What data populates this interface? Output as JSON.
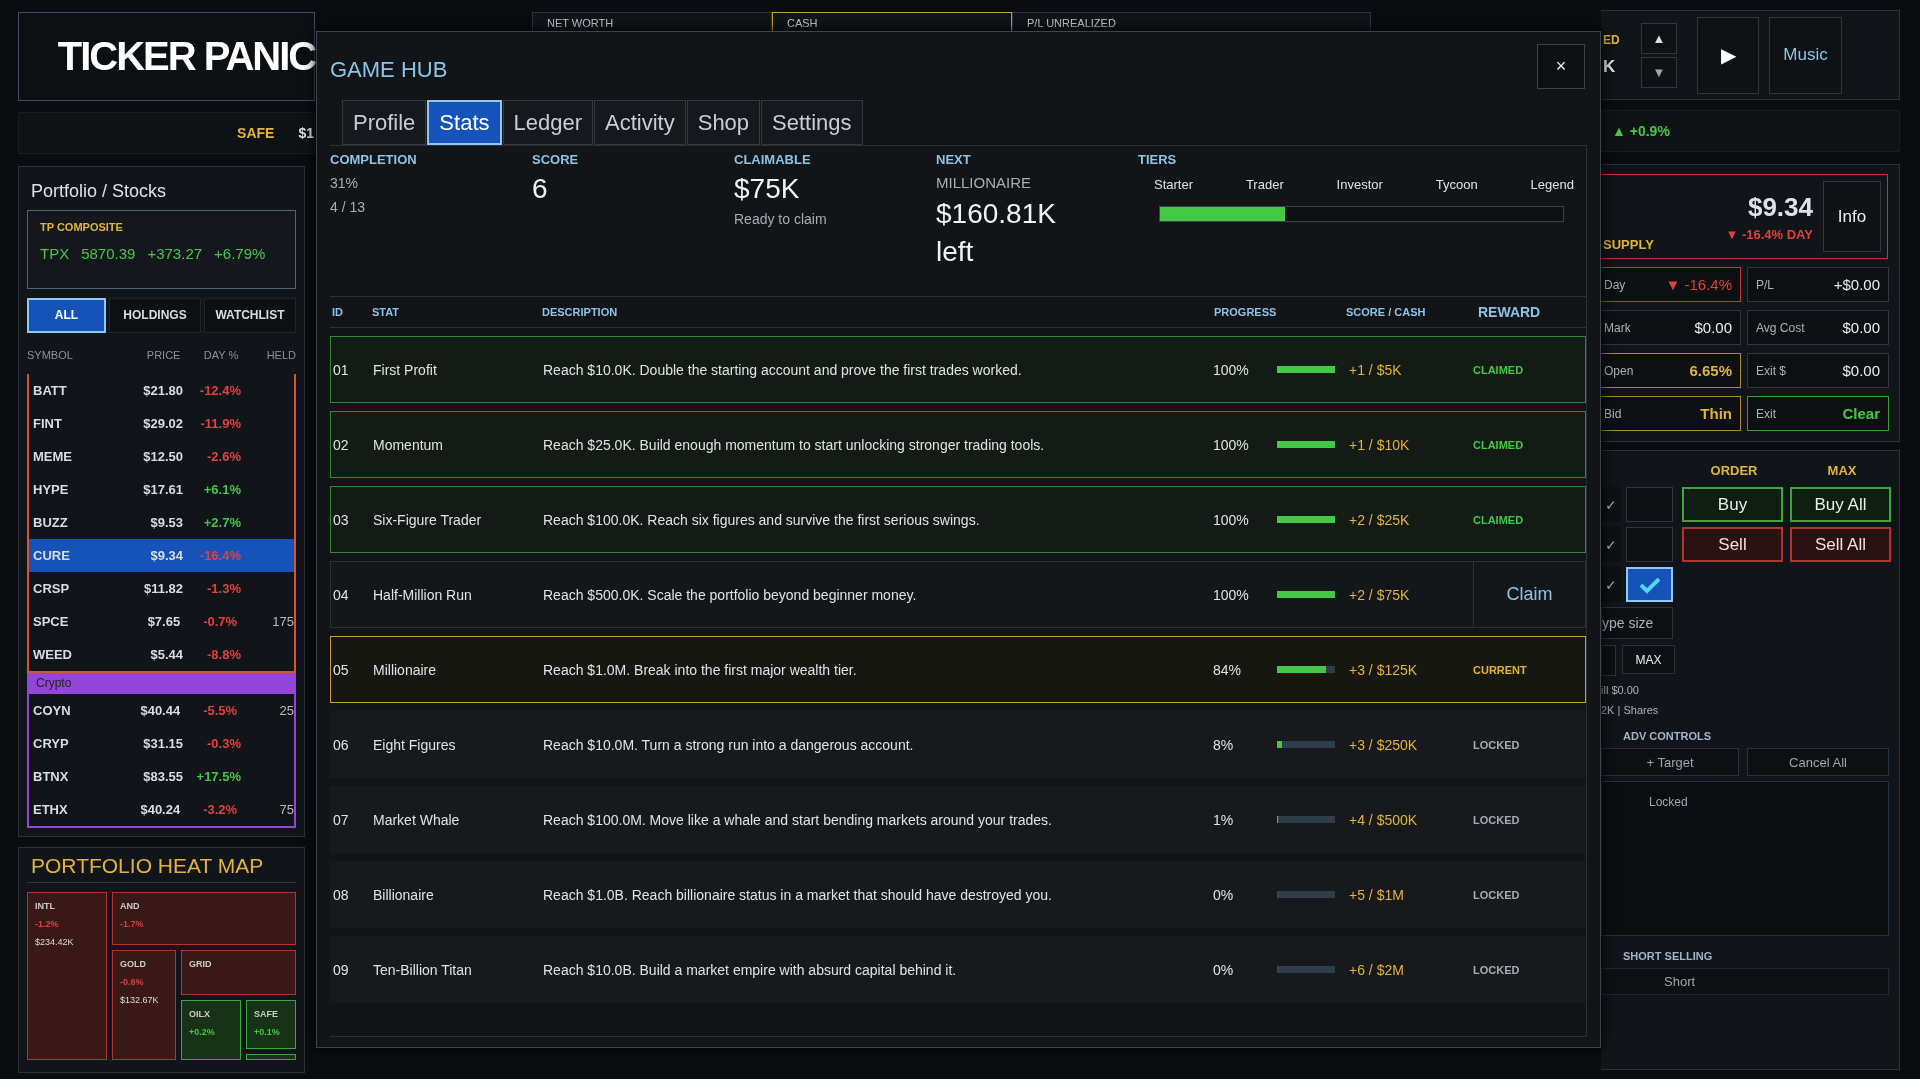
{
  "logo": {
    "title": "TICKER PANIC"
  },
  "ticker_strip": {
    "label": "SAFE",
    "value": "$1"
  },
  "portfolio": {
    "title": "Portfolio / Stocks",
    "composite": {
      "label": "TP COMPOSITE",
      "symbol": "TPX",
      "value": "5870.39",
      "change": "+373.27",
      "percent": "+6.79%"
    },
    "filters": [
      {
        "label": "ALL",
        "selected": true
      },
      {
        "label": "HOLDINGS",
        "selected": false
      },
      {
        "label": "WATCHLIST",
        "selected": false
      }
    ],
    "columns": [
      "SYMBOL",
      "PRICE",
      "DAY %",
      "HELD"
    ],
    "groups": [
      {
        "color": "#d9542b",
        "rows": [
          {
            "symbol": "BATT",
            "price": "$21.80",
            "change": "-12.4%",
            "rising": false,
            "selected": false
          },
          {
            "symbol": "FINT",
            "price": "$29.02",
            "change": "-11.9%",
            "rising": false,
            "selected": false
          },
          {
            "symbol": "MEME",
            "price": "$12.50",
            "change": "-2.6%",
            "rising": false,
            "selected": false
          },
          {
            "symbol": "HYPE",
            "price": "$17.61",
            "change": "+6.1%",
            "rising": true,
            "selected": false
          },
          {
            "symbol": "BUZZ",
            "price": "$9.53",
            "change": "+2.7%",
            "rising": true,
            "selected": false
          },
          {
            "symbol": "CURE",
            "price": "$9.34",
            "change": "-16.4%",
            "rising": false,
            "selected": true
          },
          {
            "symbol": "CRSP",
            "price": "$11.82",
            "change": "-1.3%",
            "rising": false,
            "selected": false
          },
          {
            "symbol": "SPCE",
            "price": "$7.65",
            "change": "-0.7%",
            "rising": false,
            "held": "175",
            "selected": false
          },
          {
            "symbol": "WEED",
            "price": "$5.44",
            "change": "-8.8%",
            "rising": false,
            "selected": false
          }
        ]
      },
      {
        "header": "Crypto",
        "color": "#9446d8",
        "rows": [
          {
            "symbol": "COYN",
            "price": "$40.44",
            "change": "-5.5%",
            "rising": false,
            "held": "25",
            "selected": false
          },
          {
            "symbol": "CRYP",
            "price": "$31.15",
            "change": "-0.3%",
            "rising": false,
            "selected": false
          },
          {
            "symbol": "BTNX",
            "price": "$83.55",
            "change": "+17.5%",
            "rising": true,
            "selected": false
          },
          {
            "symbol": "ETHX",
            "price": "$40.24",
            "change": "-3.2%",
            "rising": false,
            "held": "75",
            "selected": false
          }
        ]
      }
    ]
  },
  "heat_map": {
    "title": "PORTFOLIO HEAT MAP",
    "tiles": [
      {
        "symbol": "INTL",
        "change": "-1.2%",
        "value": "$234.42K",
        "rising": false
      },
      {
        "symbol": "AND",
        "change": "-1.7%",
        "rising": false
      },
      {
        "symbol": "GOLD",
        "change": "-0.6%",
        "value": "$132.67K",
        "rising": false
      },
      {
        "symbol": "GRID",
        "rising": false
      },
      {
        "symbol": "OILX",
        "change": "+0.2%",
        "rising": true
      },
      {
        "symbol": "SAFE",
        "change": "+0.1%",
        "rising": true
      },
      {
        "rising": true
      }
    ]
  },
  "top_cards": [
    {
      "label": "NET WORTH",
      "highlighted": false
    },
    {
      "label": "CASH",
      "highlighted": true
    },
    {
      "label": "P/L UNREALIZED",
      "highlighted": false
    }
  ],
  "game_hub": {
    "title": "GAME HUB",
    "close": "×",
    "tabs": [
      {
        "label": "Profile",
        "selected": false
      },
      {
        "label": "Stats",
        "selected": true
      },
      {
        "label": "Ledger",
        "selected": false
      },
      {
        "label": "Activity",
        "selected": false
      },
      {
        "label": "Shop",
        "selected": false
      },
      {
        "label": "Settings",
        "selected": false
      }
    ],
    "summary": {
      "completion": {
        "label": "COMPLETION",
        "percent": "31%",
        "count": "4 / 13"
      },
      "score": {
        "label": "SCORE",
        "value": "6"
      },
      "claimable": {
        "label": "CLAIMABLE",
        "value": "$75K",
        "note": "Ready to claim"
      },
      "next": {
        "label": "NEXT",
        "name": "MILLIONAIRE",
        "value": "$160.81K left"
      },
      "tiers": {
        "label": "TIERS",
        "names": [
          "Starter",
          "Trader",
          "Investor",
          "Tycoon",
          "Legend"
        ],
        "level": 0.31
      }
    },
    "columns": [
      "ID",
      "STAT",
      "DESCRIPTION",
      "PROGRESS",
      "SCORE / CASH",
      "REWARD"
    ],
    "rows": [
      {
        "id": "01",
        "stat": "First Profit",
        "description": "Reach $10.0K. Double the starting account and prove the first trades worked.",
        "percent": "100%",
        "level": 1,
        "score_cash": "+1 / $5K",
        "reward": "CLAIMED",
        "kind": "claimed"
      },
      {
        "id": "02",
        "stat": "Momentum",
        "description": "Reach $25.0K. Build enough momentum to start unlocking stronger trading tools.",
        "percent": "100%",
        "level": 1,
        "score_cash": "+1 / $10K",
        "reward": "CLAIMED",
        "kind": "claimed"
      },
      {
        "id": "03",
        "stat": "Six-Figure Trader",
        "description": "Reach $100.0K. Reach six figures and survive the first serious swings.",
        "percent": "100%",
        "level": 1,
        "score_cash": "+2 / $25K",
        "reward": "CLAIMED",
        "kind": "claimed"
      },
      {
        "id": "04",
        "stat": "Half-Million Run",
        "description": "Reach $500.0K. Scale the portfolio beyond beginner money.",
        "percent": "100%",
        "level": 1,
        "score_cash": "+2 / $75K",
        "reward": "Claim",
        "kind": "claim"
      },
      {
        "id": "05",
        "stat": "Millionaire",
        "description": "Reach $1.0M. Break into the first major wealth tier.",
        "percent": "84%",
        "level": 0.84,
        "score_cash": "+3 / $125K",
        "reward": "CURRENT",
        "kind": "current"
      },
      {
        "id": "06",
        "stat": "Eight Figures",
        "description": "Reach $10.0M. Turn a strong run into a dangerous account.",
        "percent": "8%",
        "level": 0.08,
        "score_cash": "+3 / $250K",
        "reward": "LOCKED",
        "kind": "locked"
      },
      {
        "id": "07",
        "stat": "Market Whale",
        "description": "Reach $100.0M. Move like a whale and start bending markets around your trades.",
        "percent": "1%",
        "level": 0.01,
        "score_cash": "+4 / $500K",
        "reward": "LOCKED",
        "kind": "locked"
      },
      {
        "id": "08",
        "stat": "Billionaire",
        "description": "Reach $1.0B. Reach billionaire status in a market that should have destroyed you.",
        "percent": "0%",
        "level": 0,
        "score_cash": "+5 / $1M",
        "reward": "LOCKED",
        "kind": "locked"
      },
      {
        "id": "09",
        "stat": "Ten-Billion Titan",
        "description": "Reach $10.0B. Build a market empire with absurd capital behind it.",
        "percent": "0%",
        "level": 0,
        "score_cash": "+6 / $2M",
        "reward": "LOCKED",
        "kind": "locked"
      }
    ]
  },
  "right_panel": {
    "speed": {
      "label": "ED",
      "value": "K",
      "up": "▲",
      "down": "▼"
    },
    "play": "▶",
    "music": "Music",
    "market_change": {
      "arrow": "▲",
      "value": "+0.9%"
    },
    "quote": {
      "price": "$9.34",
      "change": "▼ -16.4% DAY",
      "sector": "SUPPLY",
      "info": "Info"
    },
    "stats": [
      {
        "label": "Day",
        "value": "▼ -16.4%",
        "kind": "alert"
      },
      {
        "label": "P/L",
        "value": "+$0.00",
        "kind": "plain"
      },
      {
        "label": "Mark",
        "value": "$0.00",
        "kind": "plain"
      },
      {
        "label": "Avg Cost",
        "value": "$0.00",
        "kind": "plain"
      },
      {
        "label": "Open",
        "value": "6.65%",
        "kind": "caution"
      },
      {
        "label": "Exit $",
        "value": "$0.00",
        "kind": "plain"
      },
      {
        "label": "Bid",
        "value": "Thin",
        "kind": "caution"
      },
      {
        "label": "Exit",
        "value": "Clear",
        "kind": "good"
      }
    ],
    "order": {
      "headers": [
        "ORDER",
        "MAX"
      ],
      "rows": [
        {
          "mark": "✓",
          "checked": false,
          "buttons": [
            {
              "label": "Buy",
              "kind": "buy"
            },
            {
              "label": "Buy All",
              "kind": "buy"
            }
          ]
        },
        {
          "mark": "✓",
          "checked": false,
          "buttons": [
            {
              "label": "Sell",
              "kind": "sell"
            },
            {
              "label": "Sell All",
              "kind": "sell"
            }
          ]
        },
        {
          "mark": "✓",
          "checked": true,
          "buttons": []
        }
      ],
      "size_placeholder": "ype size",
      "max": "MAX",
      "fill": "ill $0.00",
      "shares": "2K | Shares"
    },
    "adv": {
      "title": "ADV CONTROLS",
      "target": "+ Target",
      "cancel": "Cancel All",
      "status": "Locked"
    },
    "short": {
      "title": "SHORT SELLING",
      "button": "Short"
    }
  }
}
